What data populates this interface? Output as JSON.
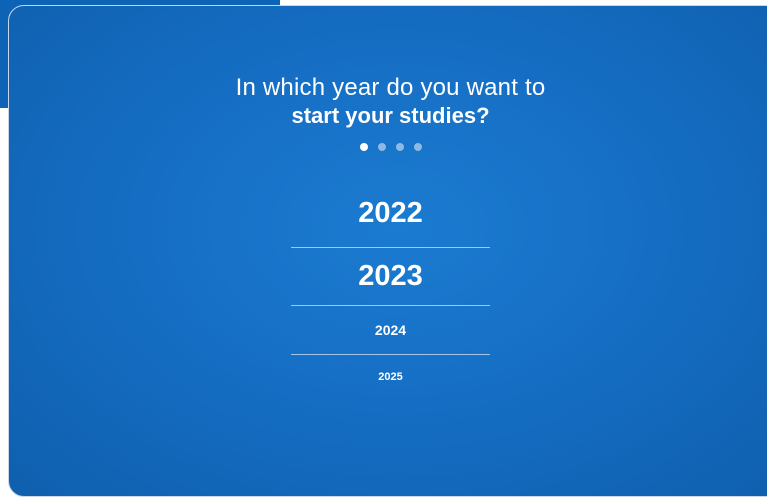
{
  "question": {
    "line1": "In which year do you want to",
    "line2": "start your studies?"
  },
  "progress": {
    "total_steps": 4,
    "current_step": 1
  },
  "years": [
    "2022",
    "2023",
    "2024",
    "2025"
  ],
  "colors": {
    "card_background": "#1670c6",
    "text": "#ffffff"
  }
}
